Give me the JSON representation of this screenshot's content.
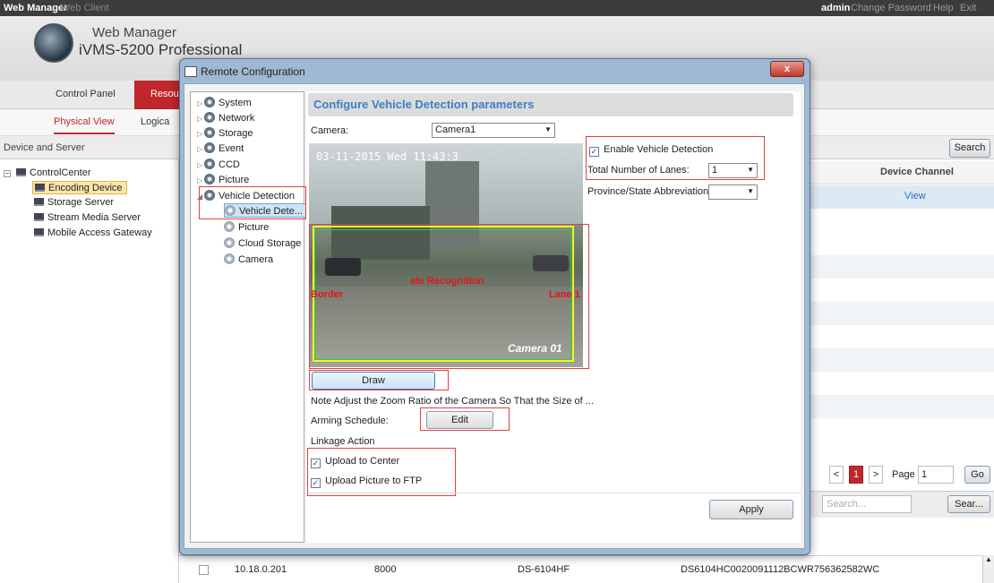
{
  "topbar": {
    "app": "Web Manager",
    "client": "Web Client",
    "user": "admin",
    "change_password": "Change Password",
    "help": "Help",
    "exit": "Exit"
  },
  "header": {
    "product_name": "Web Manager",
    "product_version": "iVMS-5200 Professional"
  },
  "main_tabs": {
    "control_panel": "Control Panel",
    "resource": "Resou"
  },
  "sub_tabs": {
    "physical_view": "Physical View",
    "logical": "Logica"
  },
  "device_tree": {
    "title": "Device and Server",
    "root": "ControlCenter",
    "items": [
      "Encoding Device",
      "Storage Server",
      "Stream Media Server",
      "Mobile Access Gateway"
    ]
  },
  "right_panel": {
    "search_button": "Search",
    "device_channel_header": "Device Channel",
    "view_link": "View",
    "page_label": "Page",
    "page_value": "1",
    "current_page": "1",
    "go_button": "Go",
    "search_placeholder": "Search...",
    "search2_button": "Sear..."
  },
  "bottom_row": {
    "ip": "10.18.0.201",
    "port": "8000",
    "model": "DS-6104HF",
    "serial": "DS6104HC0020091112BCWR756362582WC"
  },
  "dialog": {
    "title": "Remote Configuration",
    "nav": [
      "System",
      "Network",
      "Storage",
      "Event",
      "CCD",
      "Picture",
      "Vehicle Detection",
      "Vehicle Dete...",
      "Picture",
      "Cloud Storage",
      "Camera"
    ],
    "section_title": "Configure Vehicle Detection parameters",
    "camera_label": "Camera:",
    "camera_value": "Camera1",
    "enable_label": "Enable Vehicle Detection",
    "enable_checked": true,
    "lanes_label": "Total Number of Lanes:",
    "lanes_value": "1",
    "province_label": "Province/State Abbreviation:",
    "province_value": "",
    "video": {
      "timestamp": "03-11-2015 Wed 11:43:3",
      "overlay_center": "ate Recognition",
      "overlay_left": "Border",
      "overlay_right": "Lane 1",
      "camera_osd": "Camera 01"
    },
    "draw_button": "Draw",
    "note": "Note Adjust the Zoom Ratio of the Camera So That the Size of ...",
    "arming_label": "Arming Schedule:",
    "edit_button": "Edit",
    "linkage_label": "Linkage Action",
    "upload_center": "Upload to Center",
    "upload_ftp": "Upload Picture to FTP",
    "apply_button": "Apply",
    "close_glyph": "x"
  }
}
